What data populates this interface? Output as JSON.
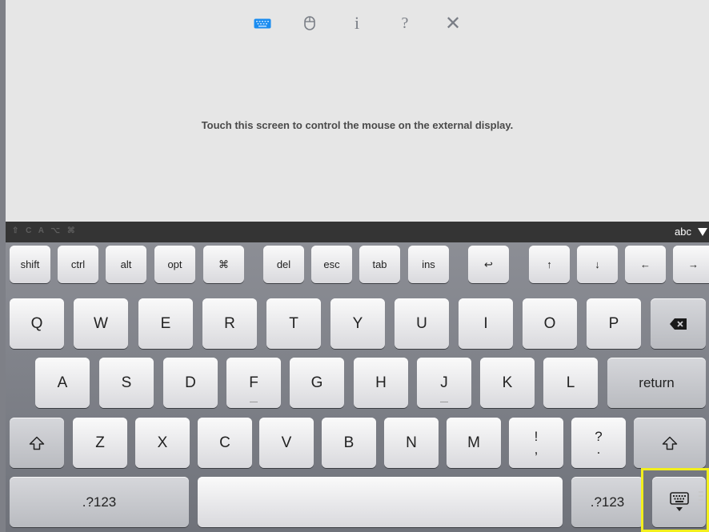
{
  "message": "Touch this screen to control the mouse on the external display.",
  "toolbar": {
    "info_glyph": "i",
    "help_glyph": "?",
    "close_glyph": "✕"
  },
  "modifier_strip": {
    "indicators": "⇧ C A ⌥ ⌘",
    "layout_toggle_label": "abc"
  },
  "function_row": [
    "shift",
    "ctrl",
    "alt",
    "opt",
    "⌘",
    "del",
    "esc",
    "tab",
    "ins",
    "↩",
    "↑",
    "↓",
    "←",
    "→"
  ],
  "letters_row1": [
    "Q",
    "W",
    "E",
    "R",
    "T",
    "Y",
    "U",
    "I",
    "O",
    "P"
  ],
  "letters_row2": [
    "A",
    "S",
    "D",
    "F",
    "G",
    "H",
    "J",
    "K",
    "L"
  ],
  "return_label": "return",
  "letters_row3": [
    "Z",
    "X",
    "C",
    "V",
    "B",
    "N",
    "M"
  ],
  "punct_keys": [
    {
      "top": "!",
      "bottom": ","
    },
    {
      "top": "?",
      "bottom": "."
    }
  ],
  "bottom_row": {
    "numbers_left": ".?123",
    "numbers_right": ".?123"
  },
  "colors": {
    "accent_keyboard_icon": "#1a8cf0",
    "highlight": "#f2ef1c"
  }
}
